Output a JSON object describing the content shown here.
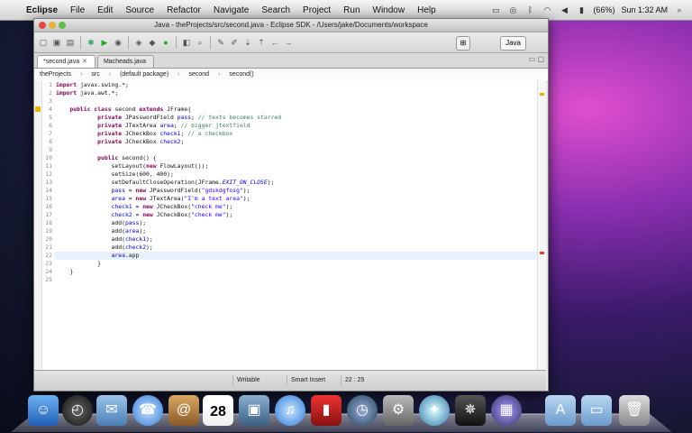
{
  "menubar": {
    "app": "Eclipse",
    "items": [
      "File",
      "Edit",
      "Source",
      "Refactor",
      "Navigate",
      "Search",
      "Project",
      "Run",
      "Window",
      "Help"
    ],
    "battery": "(66%)",
    "clock": "Sun 1:32 AM"
  },
  "window": {
    "title": "Java - theProjects/src/second.java - Eclipse SDK - /Users/jake/Documents/workspace",
    "perspective": "Java"
  },
  "tabs": [
    {
      "label": "*second.java",
      "active": true
    },
    {
      "label": "Macheads.java",
      "active": false
    }
  ],
  "breadcrumb": [
    "theProjects",
    "src",
    "(default package)",
    "second",
    "second()"
  ],
  "code_lines": [
    "import javax.swing.*;",
    "import java.awt.*;",
    "",
    "    public class second extends JFrame{",
    "            private JPasswordField pass; // texts becomes starred",
    "            private JTextArea area; // bigger jtextfield",
    "            private JCheckBox check1; // a checkbox",
    "            private JCheckBox check2;",
    "",
    "            public second() {",
    "                setLayout(new FlowLayout());",
    "                setSize(600, 400);",
    "                setDefaultCloseOperation(JFrame.EXIT_ON_CLOSE);",
    "                pass = new JPasswordField(\"gdskdgfosg\");",
    "                area = new JTextArea(\"I'm a text area\");",
    "                check1 = new JCheckBox(\"check me\");",
    "                check2 = new JCheckBox(\"check me\");",
    "                add(pass);",
    "                add(area);",
    "                add(check1);",
    "                add(check2);",
    "                area.app",
    "            }",
    "    }",
    ""
  ],
  "status": {
    "writable": "Writable",
    "insert_mode": "Smart Insert",
    "position": "22 : 25"
  },
  "dock": {
    "calendar_day": "28",
    "icons": [
      "finder-icon",
      "dashboard-icon",
      "mail-stamp-icon",
      "ichat-icon",
      "address-book-icon",
      "ical-icon",
      "iphoto-icon",
      "itunes-icon",
      "photo-booth-icon",
      "time-machine-icon",
      "system-preferences-icon",
      "safari-icon",
      "imovie-icon",
      "spaces-icon",
      "applications-folder-icon",
      "documents-folder-icon",
      "trash-icon"
    ]
  }
}
